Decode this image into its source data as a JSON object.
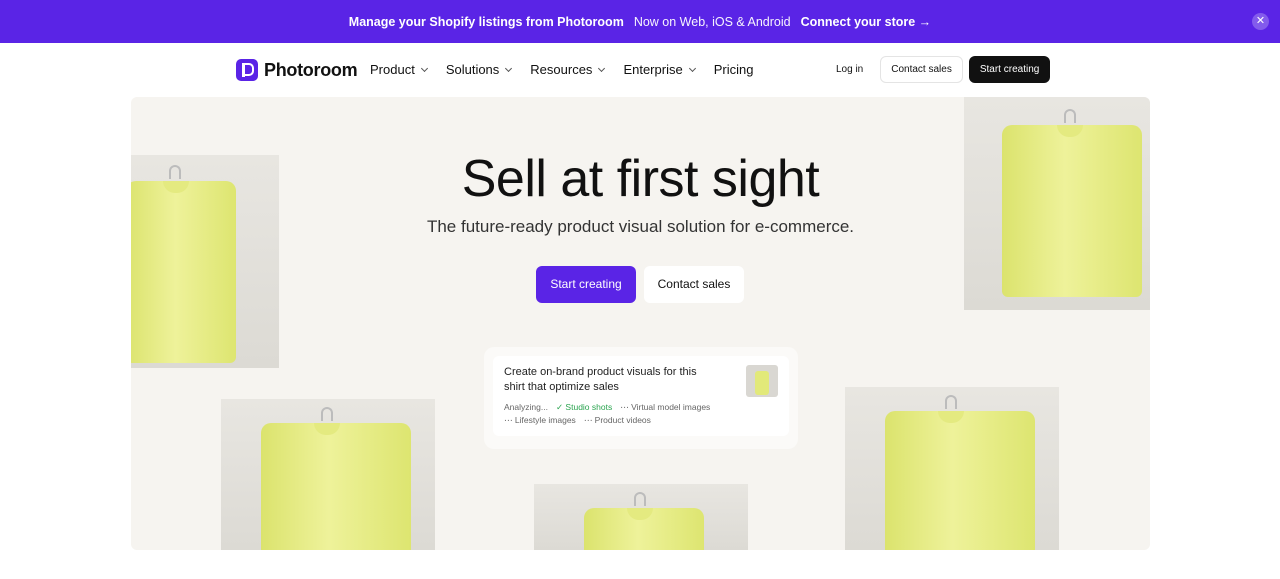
{
  "banner": {
    "headline": "Manage your Shopify listings from Photoroom",
    "sub": "Now on Web, iOS & Android",
    "cta": "Connect your store →",
    "close": "✕"
  },
  "nav": {
    "logo": "Photoroom",
    "menu": [
      {
        "label": "Product"
      },
      {
        "label": "Solutions"
      },
      {
        "label": "Resources"
      },
      {
        "label": "Enterprise"
      },
      {
        "label": "Pricing"
      }
    ],
    "login": "Log in",
    "contact": "Contact sales",
    "start": "Start creating"
  },
  "hero": {
    "title": "Sell at first sight",
    "subtitle": "The future-ready product visual solution for e-commerce.",
    "primary": "Start creating",
    "secondary": "Contact sales"
  },
  "card": {
    "prompt": "Create on-brand product visuals for this shirt that optimize sales",
    "tags": [
      {
        "label": "Analyzing..."
      },
      {
        "label": "✓ Studio shots"
      },
      {
        "label": "⋯ Virtual model images"
      },
      {
        "label": "⋯ Lifestyle images"
      },
      {
        "label": "⋯ Product videos"
      }
    ]
  },
  "colors": {
    "brand": "#5a24e6",
    "dark": "#111111",
    "hero_bg": "#f6f4f0",
    "shirt": "#e6ec88"
  }
}
